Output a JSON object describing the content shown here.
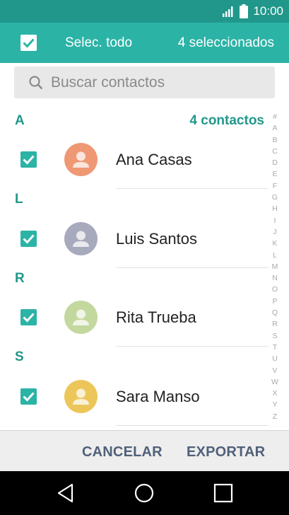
{
  "status_bar": {
    "time": "10:00",
    "icons": [
      "signal-icon",
      "battery-icon"
    ]
  },
  "action_bar": {
    "select_all_label": "Selec. todo",
    "selected_count": "4 seleccionados"
  },
  "search": {
    "placeholder": "Buscar contactos"
  },
  "list": {
    "contacts_count": "4 contactos",
    "sections": [
      {
        "letter": "A",
        "contact": {
          "name": "Ana Casas",
          "avatar_color": "#ef9874",
          "checked": true
        }
      },
      {
        "letter": "L",
        "contact": {
          "name": "Luis Santos",
          "avatar_color": "#a7a9bd",
          "checked": true
        }
      },
      {
        "letter": "R",
        "contact": {
          "name": "Rita Trueba",
          "avatar_color": "#c3d89e",
          "checked": true
        }
      },
      {
        "letter": "S",
        "contact": {
          "name": "Sara Manso",
          "avatar_color": "#ecc659",
          "checked": true
        }
      }
    ]
  },
  "index_letters": [
    "#",
    "A",
    "B",
    "C",
    "D",
    "E",
    "F",
    "G",
    "H",
    "I",
    "J",
    "K",
    "L",
    "M",
    "N",
    "O",
    "P",
    "Q",
    "R",
    "S",
    "T",
    "U",
    "V",
    "W",
    "X",
    "Y",
    "Z"
  ],
  "footer": {
    "cancel_label": "CANCELAR",
    "export_label": "EXPORTAR"
  },
  "nav_bar": {
    "icons": [
      "back-icon",
      "home-icon",
      "recents-icon"
    ]
  },
  "colors": {
    "primary": "#2bb3a6",
    "primary_dark": "#21978b",
    "footer_text": "#506179"
  }
}
